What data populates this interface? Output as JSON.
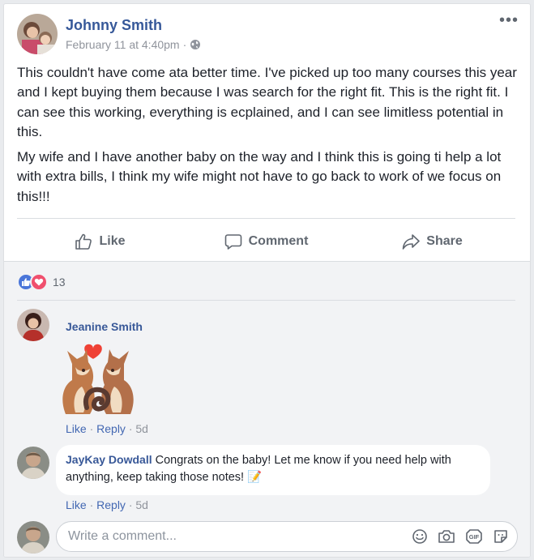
{
  "post": {
    "author": "Johnny Smith",
    "timestamp": "February 11 at 4:40pm",
    "separator": "·",
    "paragraphs": [
      "This couldn't have come ata better time. I've picked up too many courses this year and I kept buying them because I was search for the right fit. This is the right fit. I can see this working, everything is ecplained, and I can see limitless potential in this.",
      "My wife and I have another baby on the way and I think this is going ti help a lot with extra bills, I think my wife might not have to go back to work of we focus on this!!!"
    ],
    "menu_glyph": "•••"
  },
  "actions": {
    "like": "Like",
    "comment": "Comment",
    "share": "Share"
  },
  "reactions": {
    "count": "13",
    "types": [
      "like",
      "love"
    ]
  },
  "comments": [
    {
      "author": "Jeanine Smith",
      "text": "",
      "sticker": "fox-couple-kissing-heart-sticker",
      "like": "Like",
      "reply": "Reply",
      "dot": "·",
      "time": "5d"
    },
    {
      "author": "JayKay Dowdall",
      "text": "Congrats on the baby! Let me know if you need help with anything, keep taking those notes!",
      "emoji": "📝",
      "like": "Like",
      "reply": "Reply",
      "dot": "·",
      "time": "5d"
    }
  ],
  "composer": {
    "placeholder": "Write a comment..."
  },
  "icons": [
    "globe-icon",
    "more-options-icon",
    "like-icon",
    "comment-icon",
    "share-icon",
    "emoji-icon",
    "camera-icon",
    "gif-icon",
    "sticker-icon"
  ],
  "colors": {
    "link": "#365899",
    "meta": "#90949c",
    "action": "#606770",
    "like": "#4a76d9",
    "love": "#f0506e",
    "comment_bg": "#f2f3f5"
  }
}
